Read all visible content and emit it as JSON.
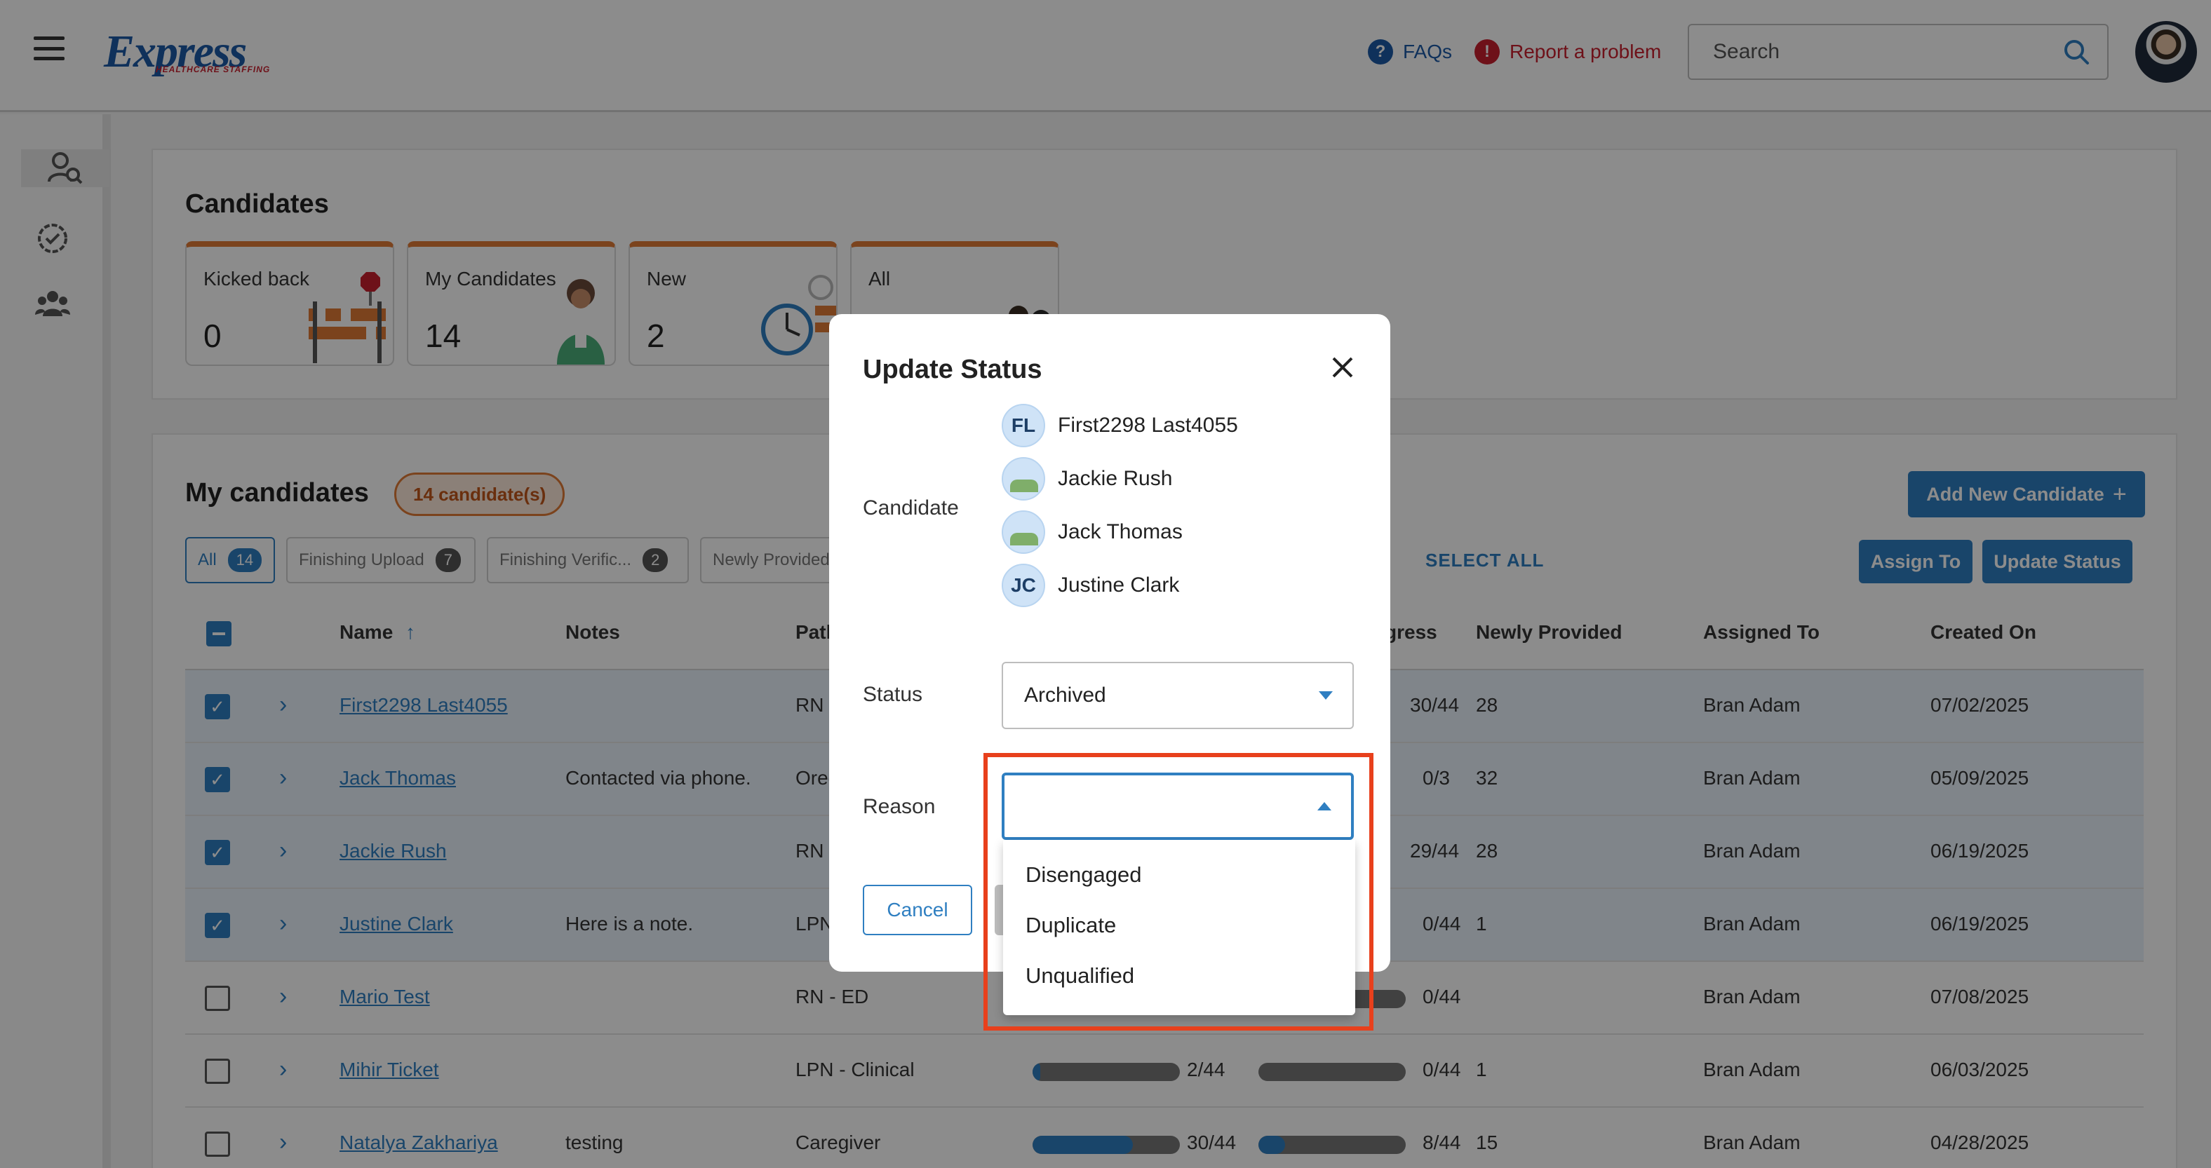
{
  "header": {
    "logo_text": "Express",
    "logo_subtext": "HEALTHCARE STAFFING",
    "faq_label": "FAQs",
    "report_label": "Report a problem",
    "search_placeholder": "Search"
  },
  "candidates_section": {
    "title": "Candidates",
    "cards": [
      {
        "label": "Kicked back",
        "count": "0"
      },
      {
        "label": "My Candidates",
        "count": "14"
      },
      {
        "label": "New",
        "count": "2"
      },
      {
        "label": "All",
        "count": ""
      }
    ]
  },
  "my_candidates": {
    "title": "My candidates",
    "count_badge": "14 candidate(s)",
    "add_button": "Add New Candidate",
    "assign_button": "Assign To",
    "update_button": "Update Status",
    "select_all": "SELECT ALL",
    "filters": [
      {
        "label": "All",
        "count": "14"
      },
      {
        "label": "Finishing Upload",
        "count": "7"
      },
      {
        "label": "Finishing Verific...",
        "count": "2"
      },
      {
        "label": "Newly Provided",
        "count": ""
      }
    ],
    "columns": {
      "name": "Name",
      "notes": "Notes",
      "path": "Path",
      "progress": "gress",
      "newly_provided": "Newly Provided",
      "assigned_to": "Assigned To",
      "created_on": "Created On"
    },
    "rows": [
      {
        "name": "First2298 Last4055",
        "notes": "",
        "path": "RN -",
        "progress2": "30/44",
        "newly": "28",
        "assigned": "Bran Adam",
        "created": "07/02/2025",
        "checked": true
      },
      {
        "name": "Jack Thomas",
        "notes": "Contacted via phone.",
        "path": "Oreg",
        "progress2": "0/3",
        "newly": "32",
        "assigned": "Bran Adam",
        "created": "05/09/2025",
        "checked": true
      },
      {
        "name": "Jackie Rush",
        "notes": "",
        "path": "RN -",
        "progress2": "29/44",
        "newly": "28",
        "assigned": "Bran Adam",
        "created": "06/19/2025",
        "checked": true
      },
      {
        "name": "Justine Clark",
        "notes": "Here is a note.",
        "path": "LPN",
        "progress2": "0/44",
        "newly": "1",
        "assigned": "Bran Adam",
        "created": "06/19/2025",
        "checked": true
      },
      {
        "name": "Mario Test",
        "notes": "",
        "path": "RN - ED",
        "progress2": "0/44",
        "newly": "",
        "assigned": "Bran Adam",
        "created": "07/08/2025",
        "checked": false
      },
      {
        "name": "Mihir Ticket",
        "notes": "",
        "path": "LPN - Clinical",
        "progress1": "2/44",
        "progress1_value": 0.05,
        "progress2": "0/44",
        "newly": "1",
        "assigned": "Bran Adam",
        "created": "06/03/2025",
        "checked": false
      },
      {
        "name": "Natalya Zakhariya",
        "notes": "testing",
        "path": "Caregiver",
        "progress1": "30/44",
        "progress1_value": 0.68,
        "progress2": "8/44",
        "newly": "15",
        "assigned": "Bran Adam",
        "created": "04/28/2025",
        "checked": false
      }
    ]
  },
  "modal": {
    "title": "Update Status",
    "candidate_label": "Candidate",
    "candidates": [
      {
        "initials": "FL",
        "name": "First2298 Last4055"
      },
      {
        "initials": "",
        "name": "Jackie Rush"
      },
      {
        "initials": "",
        "name": "Jack Thomas"
      },
      {
        "initials": "JC",
        "name": "Justine Clark"
      }
    ],
    "status_label": "Status",
    "status_value": "Archived",
    "reason_label": "Reason",
    "reason_value": "",
    "reason_options": [
      "Disengaged",
      "Duplicate",
      "Unqualified"
    ],
    "cancel_button": "Cancel"
  },
  "colors": {
    "brand_blue": "#2f7fc1",
    "accent_orange": "#e07b36",
    "report_red": "#c8202f",
    "highlight_red": "#e8401c"
  }
}
